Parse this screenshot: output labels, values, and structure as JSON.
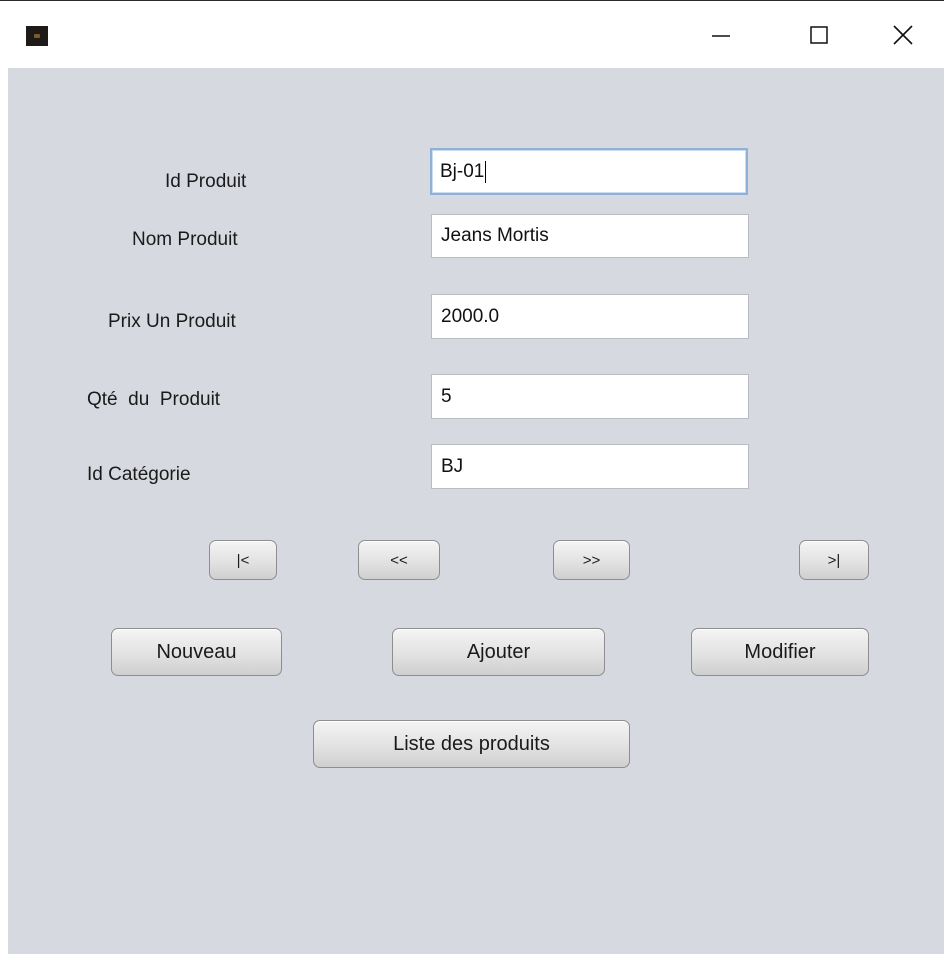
{
  "titlebar": {
    "icon": "app-icon",
    "minimize_icon": "minimize-icon",
    "maximize_icon": "maximize-icon",
    "close_icon": "close-icon"
  },
  "form": {
    "id_produit": {
      "label": "Id Produit",
      "value": "Bj-01"
    },
    "nom_produit": {
      "label": "Nom Produit",
      "value": "Jeans Mortis"
    },
    "prix_produit": {
      "label": "Prix Un Produit",
      "value": "2000.0"
    },
    "qte_produit": {
      "label": "Qté  du  Produit",
      "value": "5"
    },
    "id_categorie": {
      "label": "Id Catégorie",
      "value": "BJ"
    }
  },
  "navigation": {
    "first": "|<",
    "previous": "<<",
    "next": ">>",
    "last": ">|"
  },
  "actions": {
    "nouveau": "Nouveau",
    "ajouter": "Ajouter",
    "modifier": "Modifier",
    "liste": "Liste des produits"
  }
}
